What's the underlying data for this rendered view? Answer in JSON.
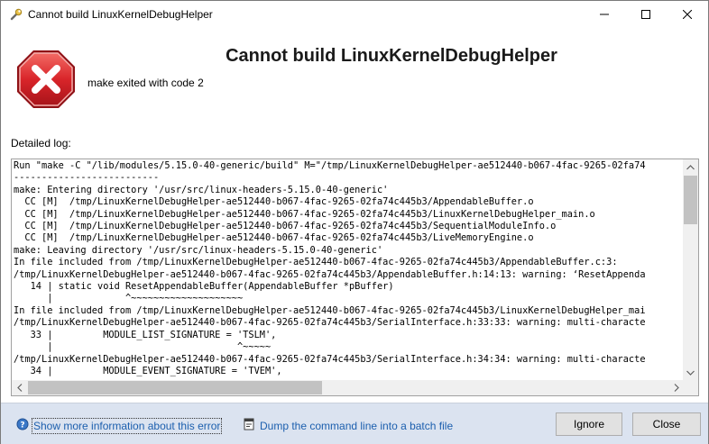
{
  "window": {
    "title": "Cannot build LinuxKernelDebugHelper"
  },
  "header": {
    "title": "Cannot build LinuxKernelDebugHelper",
    "subtitle": "make exited with code 2"
  },
  "log": {
    "label": "Detailed log:",
    "lines": [
      "Run \"make -C \"/lib/modules/5.15.0-40-generic/build\" M=\"/tmp/LinuxKernelDebugHelper-ae512440-b067-4fac-9265-02fa74",
      "--------------------------",
      "make: Entering directory '/usr/src/linux-headers-5.15.0-40-generic'",
      "  CC [M]  /tmp/LinuxKernelDebugHelper-ae512440-b067-4fac-9265-02fa74c445b3/AppendableBuffer.o",
      "  CC [M]  /tmp/LinuxKernelDebugHelper-ae512440-b067-4fac-9265-02fa74c445b3/LinuxKernelDebugHelper_main.o",
      "  CC [M]  /tmp/LinuxKernelDebugHelper-ae512440-b067-4fac-9265-02fa74c445b3/SequentialModuleInfo.o",
      "  CC [M]  /tmp/LinuxKernelDebugHelper-ae512440-b067-4fac-9265-02fa74c445b3/LiveMemoryEngine.o",
      "make: Leaving directory '/usr/src/linux-headers-5.15.0-40-generic'",
      "In file included from /tmp/LinuxKernelDebugHelper-ae512440-b067-4fac-9265-02fa74c445b3/AppendableBuffer.c:3:",
      "/tmp/LinuxKernelDebugHelper-ae512440-b067-4fac-9265-02fa74c445b3/AppendableBuffer.h:14:13: warning: ‘ResetAppenda",
      "   14 | static void ResetAppendableBuffer(AppendableBuffer *pBuffer)",
      "      |             ^~~~~~~~~~~~~~~~~~~~~",
      "In file included from /tmp/LinuxKernelDebugHelper-ae512440-b067-4fac-9265-02fa74c445b3/LinuxKernelDebugHelper_mai",
      "/tmp/LinuxKernelDebugHelper-ae512440-b067-4fac-9265-02fa74c445b3/SerialInterface.h:33:33: warning: multi-characte",
      "   33 |         MODULE_LIST_SIGNATURE = 'TSLM',",
      "      |                                 ^~~~~~",
      "/tmp/LinuxKernelDebugHelper-ae512440-b067-4fac-9265-02fa74c445b3/SerialInterface.h:34:34: warning: multi-characte",
      "   34 |         MODULE_EVENT_SIGNATURE = 'TVEM',"
    ]
  },
  "footer": {
    "more_info_link": "Show more information about this error",
    "dump_link": "Dump the command line into a batch file",
    "ignore_label": "Ignore",
    "close_label": "Close"
  },
  "colors": {
    "footer_bg": "#dbe3f0",
    "link": "#1c5fae",
    "error_red": "#d9252a"
  }
}
